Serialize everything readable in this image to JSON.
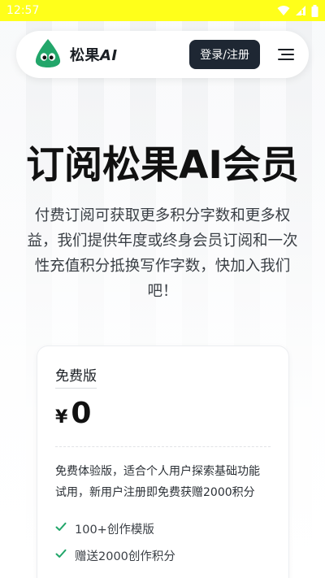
{
  "status_bar": {
    "time": "12:57",
    "icons": [
      "wifi-icon",
      "signal-icon",
      "battery-icon"
    ],
    "background_color": "#ffff1a"
  },
  "navbar": {
    "logo_text": "松果",
    "logo_text_ai": "AI",
    "logo_icon": "pinecone-mascot-icon",
    "login_label": "登录/注册",
    "menu_icon": "hamburger-menu-icon"
  },
  "hero": {
    "title": "订阅松果AI会员",
    "description": "付费订阅可获取更多积分字数和更多权益，我们提供年度或终身会员订阅和一次性充值积分抵换写作字数，快加入我们吧！"
  },
  "plan": {
    "name": "免费版",
    "currency": "¥",
    "price": "0",
    "description": "免费体验版，适合个人用户探索基础功能试用，新用户注册即免费获赠2000积分",
    "features": [
      "100+创作模版",
      "赠送2000创作积分"
    ],
    "check_color": "#22a66a"
  },
  "colors": {
    "brand_green": "#22a66a",
    "dark_button": "#1e2733"
  }
}
